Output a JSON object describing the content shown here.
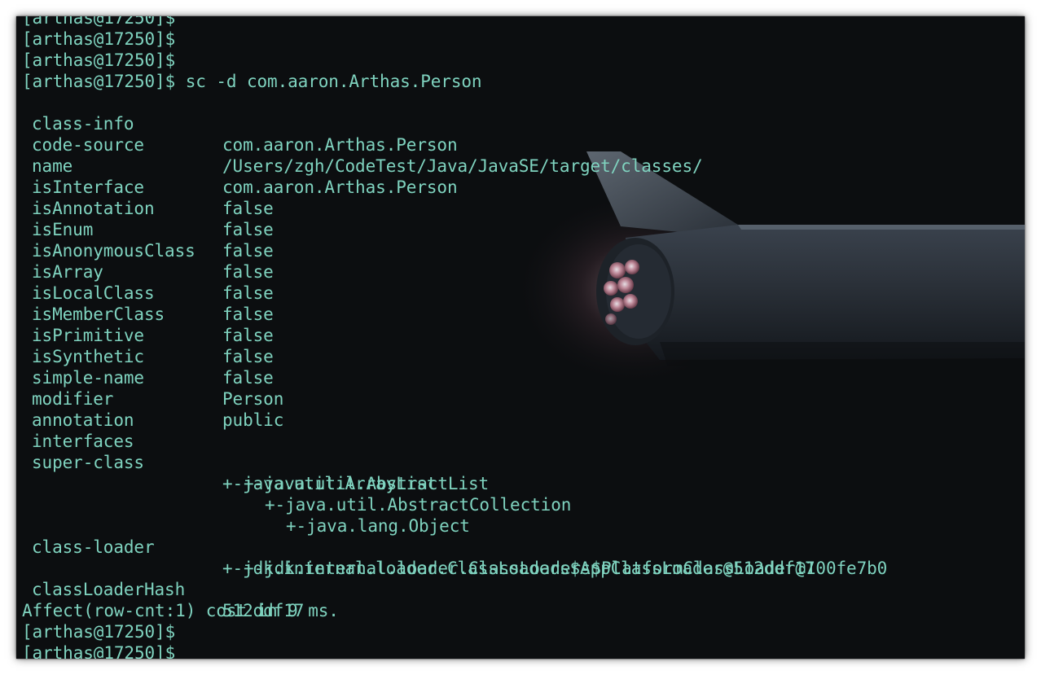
{
  "terminal": {
    "prompt": "[arthas@17250]$",
    "command": "sc -d com.aaron.Arthas.Person",
    "class_info": {
      "class_info": {
        "key": "class-info",
        "value": "com.aaron.Arthas.Person"
      },
      "code_source": {
        "key": "code-source",
        "value": "/Users/zgh/CodeTest/Java/JavaSE/target/classes/"
      },
      "name": {
        "key": "name",
        "value": "com.aaron.Arthas.Person"
      },
      "is_interface": {
        "key": "isInterface",
        "value": "false"
      },
      "is_annotation": {
        "key": "isAnnotation",
        "value": "false"
      },
      "is_enum": {
        "key": "isEnum",
        "value": "false"
      },
      "is_anonymous_class": {
        "key": "isAnonymousClass",
        "value": "false"
      },
      "is_array": {
        "key": "isArray",
        "value": "false"
      },
      "is_local_class": {
        "key": "isLocalClass",
        "value": "false"
      },
      "is_member_class": {
        "key": "isMemberClass",
        "value": "false"
      },
      "is_primitive": {
        "key": "isPrimitive",
        "value": "false"
      },
      "is_synthetic": {
        "key": "isSynthetic",
        "value": "false"
      },
      "simple_name": {
        "key": "simple-name",
        "value": "Person"
      },
      "modifier": {
        "key": "modifier",
        "value": "public"
      },
      "annotation": {
        "key": "annotation",
        "value": ""
      },
      "interfaces": {
        "key": "interfaces",
        "value": ""
      },
      "super_class": {
        "key": "super-class",
        "chain": [
          "+-java.util.ArrayList",
          "+-java.util.AbstractList",
          "+-java.util.AbstractCollection",
          "+-java.lang.Object"
        ]
      },
      "class_loader": {
        "key": "class-loader",
        "chain": [
          "+-jdk.internal.loader.ClassLoaders$AppClassLoader@512ddf17",
          "+-jdk.internal.loader.ClassLoaders$PlatformClassLoader@100fe7b0"
        ]
      },
      "class_loader_hash": {
        "key": "classLoaderHash",
        "value": "512ddf17"
      }
    },
    "summary": "Affect(row-cnt:1) cost in 9 ms.",
    "colors": {
      "background": "#0c0e10",
      "text": "#7fd3bf"
    }
  }
}
